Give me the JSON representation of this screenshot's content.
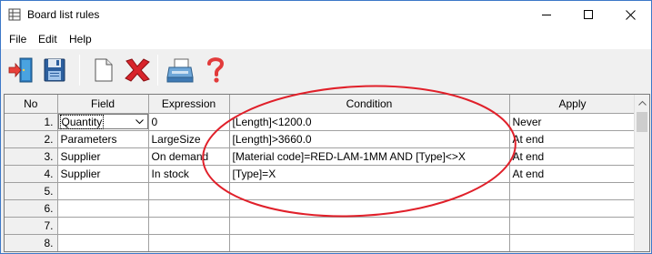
{
  "window": {
    "title": "Board list rules",
    "controls": {
      "minimize": "minimize",
      "maximize": "maximize",
      "close": "close"
    }
  },
  "menu": {
    "items": [
      {
        "label": "File"
      },
      {
        "label": "Edit"
      },
      {
        "label": "Help"
      }
    ]
  },
  "toolbar": {
    "buttons": [
      {
        "icon": "exit-door-icon",
        "tooltip": ""
      },
      {
        "icon": "save-floppy-icon",
        "tooltip": ""
      },
      {
        "icon": "new-document-icon",
        "tooltip": ""
      },
      {
        "icon": "delete-x-icon",
        "tooltip": ""
      },
      {
        "icon": "printer-icon",
        "tooltip": ""
      },
      {
        "icon": "help-question-icon",
        "tooltip": ""
      }
    ]
  },
  "grid": {
    "columns": [
      "No",
      "Field",
      "Expression",
      "Condition",
      "Apply"
    ],
    "rows": [
      {
        "no": "1.",
        "field": "Quantity",
        "expression": "0",
        "condition": "[Length]<1200.0",
        "apply": "Never",
        "editing": true
      },
      {
        "no": "2.",
        "field": "Parameters",
        "expression": "LargeSize",
        "condition": "[Length]>3660.0",
        "apply": "At end"
      },
      {
        "no": "3.",
        "field": "Supplier",
        "expression": "On demand",
        "condition": "[Material code]=RED-LAM-1MM AND [Type]<>X",
        "apply": "At end"
      },
      {
        "no": "4.",
        "field": "Supplier",
        "expression": "In stock",
        "condition": "[Type]=X",
        "apply": "At end"
      },
      {
        "no": "5.",
        "field": "",
        "expression": "",
        "condition": "",
        "apply": ""
      },
      {
        "no": "6.",
        "field": "",
        "expression": "",
        "condition": "",
        "apply": ""
      },
      {
        "no": "7.",
        "field": "",
        "expression": "",
        "condition": "",
        "apply": ""
      },
      {
        "no": "8.",
        "field": "",
        "expression": "",
        "condition": "",
        "apply": ""
      }
    ]
  },
  "colors": {
    "annotation": "#e0202a",
    "window_border": "#3c78c8",
    "grid_line": "#a0a0a0"
  }
}
